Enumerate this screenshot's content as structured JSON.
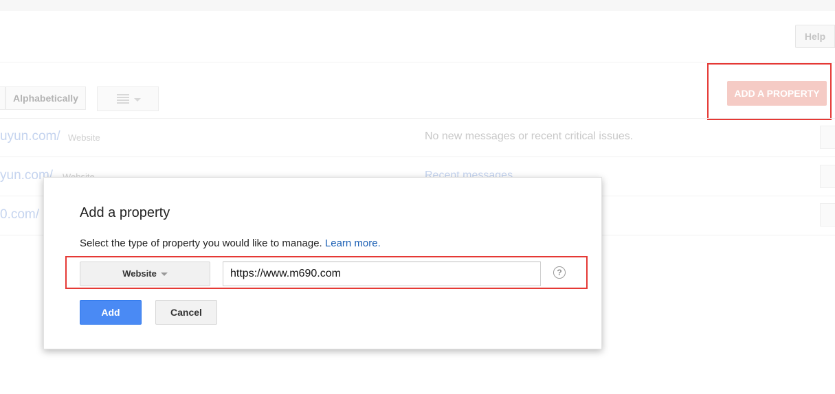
{
  "header": {
    "help_label": "Help"
  },
  "toolbar": {
    "sort_label": "Alphabetically",
    "view_icon": "list-view-icon",
    "add_property_label": "ADD A PROPERTY"
  },
  "properties": [
    {
      "url": "uyun.com/",
      "type": "Website",
      "message": "No new messages or recent critical issues."
    },
    {
      "url": "yun.com/",
      "type": "Website",
      "message": "Recent messages"
    },
    {
      "url": "0.com/",
      "type": "",
      "message": ""
    }
  ],
  "dialog": {
    "title": "Add a property",
    "description": "Select the type of property you would like to manage.",
    "learn_more": "Learn more.",
    "type_selected": "Website",
    "url_value": "https://www.m690.com",
    "help_icon": "question-circle-icon",
    "add_label": "Add",
    "cancel_label": "Cancel"
  },
  "highlight_color": "#e53935",
  "accent_color": "#4a8af4"
}
